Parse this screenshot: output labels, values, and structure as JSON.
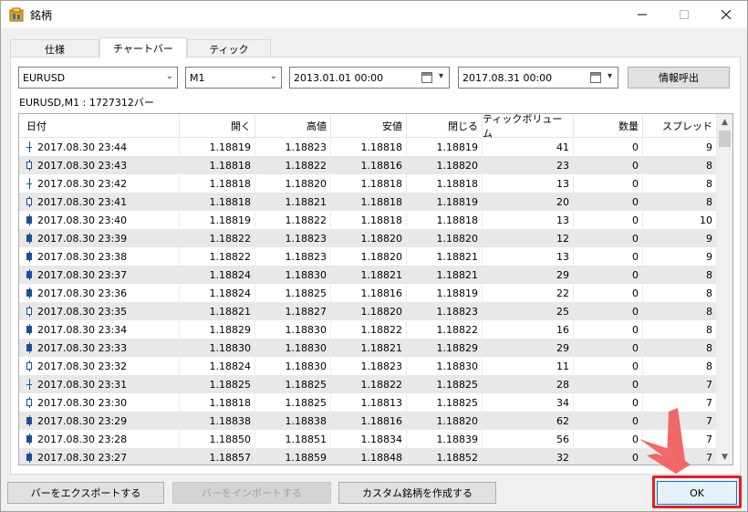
{
  "window": {
    "title": "銘柄"
  },
  "tabs": [
    {
      "label": "仕様",
      "active": false
    },
    {
      "label": "チャートバー",
      "active": true
    },
    {
      "label": "ティック",
      "active": false
    }
  ],
  "controls": {
    "symbol": "EURUSD",
    "timeframe": "M1",
    "from_date": "2013.01.01 00:00",
    "to_date": "2017.08.31 00:00",
    "request_button": "情報呼出"
  },
  "info_line": "EURUSD,M1 : 1727312バー",
  "table": {
    "columns": [
      "日付",
      "開く",
      "高値",
      "安値",
      "閉じる",
      "ティックボリューム",
      "数量",
      "スプレッド"
    ],
    "rows": [
      {
        "candle": "doji",
        "date": "2017.08.30 23:44",
        "open": "1.18819",
        "high": "1.18823",
        "low": "1.18818",
        "close": "1.18819",
        "tick_volume": "41",
        "volume": "0",
        "spread": "9"
      },
      {
        "candle": "bear",
        "date": "2017.08.30 23:43",
        "open": "1.18818",
        "high": "1.18822",
        "low": "1.18816",
        "close": "1.18820",
        "tick_volume": "23",
        "volume": "0",
        "spread": "8"
      },
      {
        "candle": "doji",
        "date": "2017.08.30 23:42",
        "open": "1.18818",
        "high": "1.18820",
        "low": "1.18818",
        "close": "1.18818",
        "tick_volume": "13",
        "volume": "0",
        "spread": "8"
      },
      {
        "candle": "bear",
        "date": "2017.08.30 23:41",
        "open": "1.18818",
        "high": "1.18821",
        "low": "1.18818",
        "close": "1.18819",
        "tick_volume": "20",
        "volume": "0",
        "spread": "8"
      },
      {
        "candle": "bull",
        "date": "2017.08.30 23:40",
        "open": "1.18819",
        "high": "1.18822",
        "low": "1.18818",
        "close": "1.18818",
        "tick_volume": "13",
        "volume": "0",
        "spread": "10"
      },
      {
        "candle": "bull",
        "date": "2017.08.30 23:39",
        "open": "1.18822",
        "high": "1.18823",
        "low": "1.18820",
        "close": "1.18820",
        "tick_volume": "12",
        "volume": "0",
        "spread": "9"
      },
      {
        "candle": "bull",
        "date": "2017.08.30 23:38",
        "open": "1.18822",
        "high": "1.18823",
        "low": "1.18820",
        "close": "1.18821",
        "tick_volume": "13",
        "volume": "0",
        "spread": "9"
      },
      {
        "candle": "bull",
        "date": "2017.08.30 23:37",
        "open": "1.18824",
        "high": "1.18830",
        "low": "1.18821",
        "close": "1.18821",
        "tick_volume": "29",
        "volume": "0",
        "spread": "8"
      },
      {
        "candle": "bull",
        "date": "2017.08.30 23:36",
        "open": "1.18824",
        "high": "1.18825",
        "low": "1.18816",
        "close": "1.18819",
        "tick_volume": "22",
        "volume": "0",
        "spread": "8"
      },
      {
        "candle": "bear",
        "date": "2017.08.30 23:35",
        "open": "1.18821",
        "high": "1.18827",
        "low": "1.18820",
        "close": "1.18823",
        "tick_volume": "25",
        "volume": "0",
        "spread": "8"
      },
      {
        "candle": "bull",
        "date": "2017.08.30 23:34",
        "open": "1.18829",
        "high": "1.18830",
        "low": "1.18822",
        "close": "1.18822",
        "tick_volume": "16",
        "volume": "0",
        "spread": "8"
      },
      {
        "candle": "bull",
        "date": "2017.08.30 23:33",
        "open": "1.18830",
        "high": "1.18830",
        "low": "1.18821",
        "close": "1.18829",
        "tick_volume": "29",
        "volume": "0",
        "spread": "8"
      },
      {
        "candle": "bear",
        "date": "2017.08.30 23:32",
        "open": "1.18824",
        "high": "1.18830",
        "low": "1.18823",
        "close": "1.18830",
        "tick_volume": "11",
        "volume": "0",
        "spread": "8"
      },
      {
        "candle": "doji",
        "date": "2017.08.30 23:31",
        "open": "1.18825",
        "high": "1.18825",
        "low": "1.18822",
        "close": "1.18825",
        "tick_volume": "28",
        "volume": "0",
        "spread": "7"
      },
      {
        "candle": "bear",
        "date": "2017.08.30 23:30",
        "open": "1.18818",
        "high": "1.18825",
        "low": "1.18813",
        "close": "1.18825",
        "tick_volume": "34",
        "volume": "0",
        "spread": "7"
      },
      {
        "candle": "bull",
        "date": "2017.08.30 23:29",
        "open": "1.18838",
        "high": "1.18838",
        "low": "1.18816",
        "close": "1.18820",
        "tick_volume": "62",
        "volume": "0",
        "spread": "7"
      },
      {
        "candle": "bull",
        "date": "2017.08.30 23:28",
        "open": "1.18850",
        "high": "1.18851",
        "low": "1.18834",
        "close": "1.18839",
        "tick_volume": "56",
        "volume": "0",
        "spread": "7"
      },
      {
        "candle": "bull",
        "date": "2017.08.30 23:27",
        "open": "1.18857",
        "high": "1.18859",
        "low": "1.18848",
        "close": "1.18852",
        "tick_volume": "32",
        "volume": "0",
        "spread": "7"
      }
    ]
  },
  "buttons": {
    "export": "バーをエクスポートする",
    "import": "バーをインポートする",
    "create_symbol": "カスタム銘柄を作成する",
    "ok": "OK"
  },
  "colors": {
    "candle": "#1a4f9c",
    "highlight": "#e02020",
    "pointer": "#f06060"
  }
}
